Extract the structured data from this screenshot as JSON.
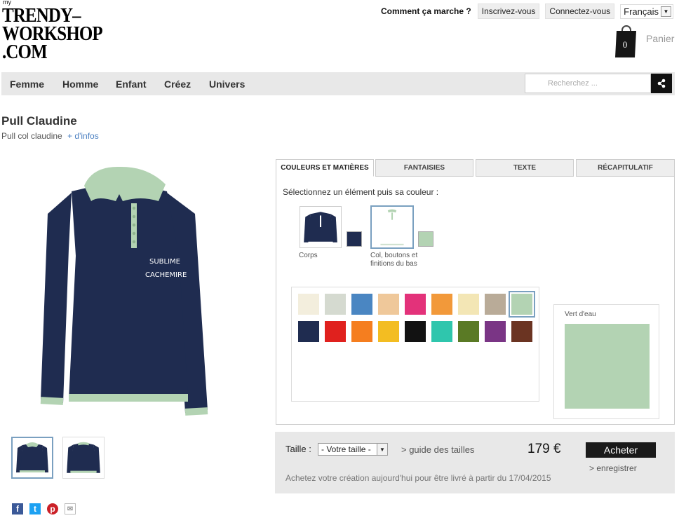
{
  "logo": {
    "my": "my",
    "lines": [
      "TRENDY–",
      "WORKSHOP",
      ".COM"
    ]
  },
  "header": {
    "how_it_works": "Comment ça marche ?",
    "signup": "Inscrivez-vous",
    "login": "Connectez-vous",
    "language": "Français",
    "cart_count": "0",
    "cart_label": "Panier"
  },
  "nav": {
    "items": [
      "Femme",
      "Homme",
      "Enfant",
      "Créez",
      "Univers"
    ],
    "search_placeholder": "Recherchez ..."
  },
  "product": {
    "title": "Pull Claudine",
    "subtitle": "Pull col claudine",
    "more_info": "+ d'infos",
    "embroidery_line1": "SUBLIME",
    "embroidery_line2": "CACHEMIRE"
  },
  "tabs": [
    "COULEURS ET MATIÈRES",
    "FANTAISIES",
    "TEXTE",
    "RÉCAPITULATIF"
  ],
  "customizer": {
    "instruction": "Sélectionnez un élément puis sa couleur :",
    "elements": [
      {
        "label": "Corps",
        "color": "#1f2c50"
      },
      {
        "label": "Col, boutons et finitions du bas",
        "color": "#b3d3b3"
      }
    ],
    "palette": [
      "#f3eedd",
      "#d5dad0",
      "#4a86c2",
      "#efc89a",
      "#e3327a",
      "#f2993a",
      "#f3e6b5",
      "#b9ab98",
      "#b3d3b3",
      "#1f2c50",
      "#e0211e",
      "#f57e1f",
      "#f3bd22",
      "#121212",
      "#2fc6ad",
      "#5a7a25",
      "#7a3585",
      "#6b3422"
    ],
    "selected_index": 8,
    "selected_name": "Vert d'eau"
  },
  "purchase": {
    "size_label": "Taille :",
    "size_value": "- Votre taille -",
    "size_guide": "> guide des tailles",
    "price": "179 €",
    "buy": "Acheter",
    "save": "> enregistrer",
    "delivery": "Achetez votre création aujourd'hui pour être livré à partir du 17/04/2015"
  },
  "social": [
    "f",
    "t",
    "p",
    "✉"
  ]
}
